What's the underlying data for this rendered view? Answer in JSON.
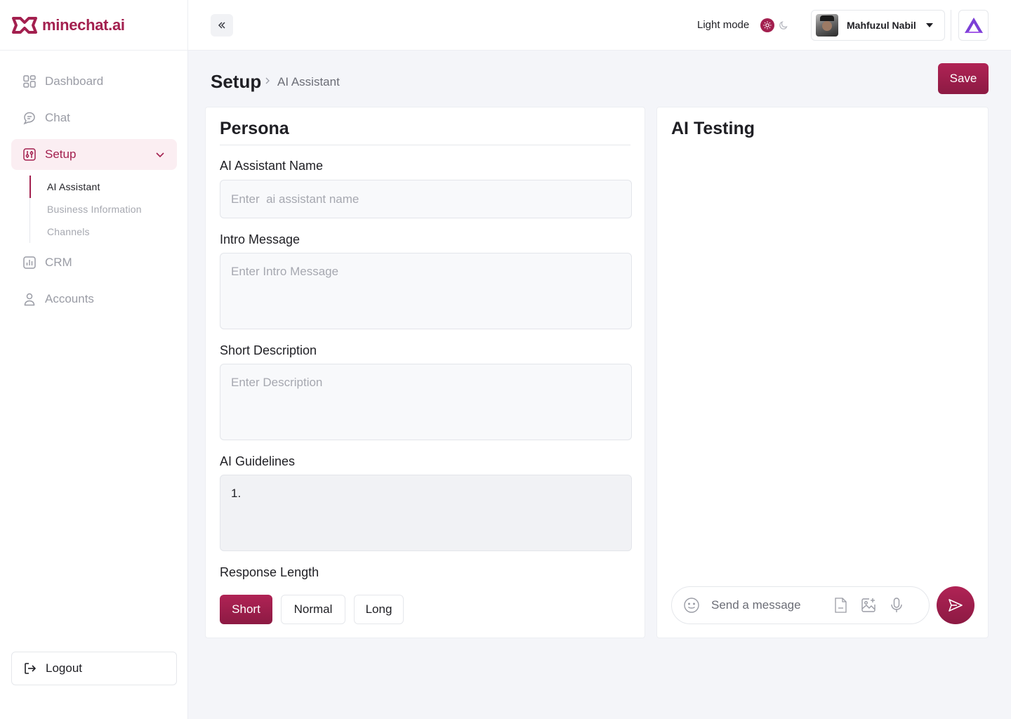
{
  "brand": {
    "name": "minechat.ai",
    "color": "#a3204f"
  },
  "sidebar": {
    "items": [
      {
        "label": "Dashboard",
        "icon": "grid-icon"
      },
      {
        "label": "Chat",
        "icon": "chat-icon"
      },
      {
        "label": "Setup",
        "icon": "sliders-icon",
        "active": true
      },
      {
        "label": "CRM",
        "icon": "bar-chart-icon"
      },
      {
        "label": "Accounts",
        "icon": "user-icon"
      }
    ],
    "setup_subitems": [
      {
        "label": "AI Assistant",
        "current": true
      },
      {
        "label": "Business Information"
      },
      {
        "label": "Channels"
      }
    ],
    "logout_label": "Logout"
  },
  "topbar": {
    "mode_label": "Light mode",
    "user_name": "Mahfuzul Nabil"
  },
  "page": {
    "title": "Setup",
    "breadcrumb": "AI Assistant",
    "save_label": "Save"
  },
  "persona": {
    "title": "Persona",
    "assistant_name": {
      "label": "AI Assistant Name",
      "placeholder": "Enter  ai assistant name",
      "value": ""
    },
    "intro_message": {
      "label": "Intro Message",
      "placeholder": "Enter Intro Message",
      "value": ""
    },
    "short_description": {
      "label": "Short Description",
      "placeholder": "Enter Description",
      "value": ""
    },
    "guidelines": {
      "label": "AI Guidelines",
      "value": "1."
    },
    "response_length": {
      "label": "Response Length",
      "options": [
        "Short",
        "Normal",
        "Long"
      ],
      "selected": "Short"
    }
  },
  "testing": {
    "title": "AI Testing",
    "message_placeholder": "Send a message"
  }
}
